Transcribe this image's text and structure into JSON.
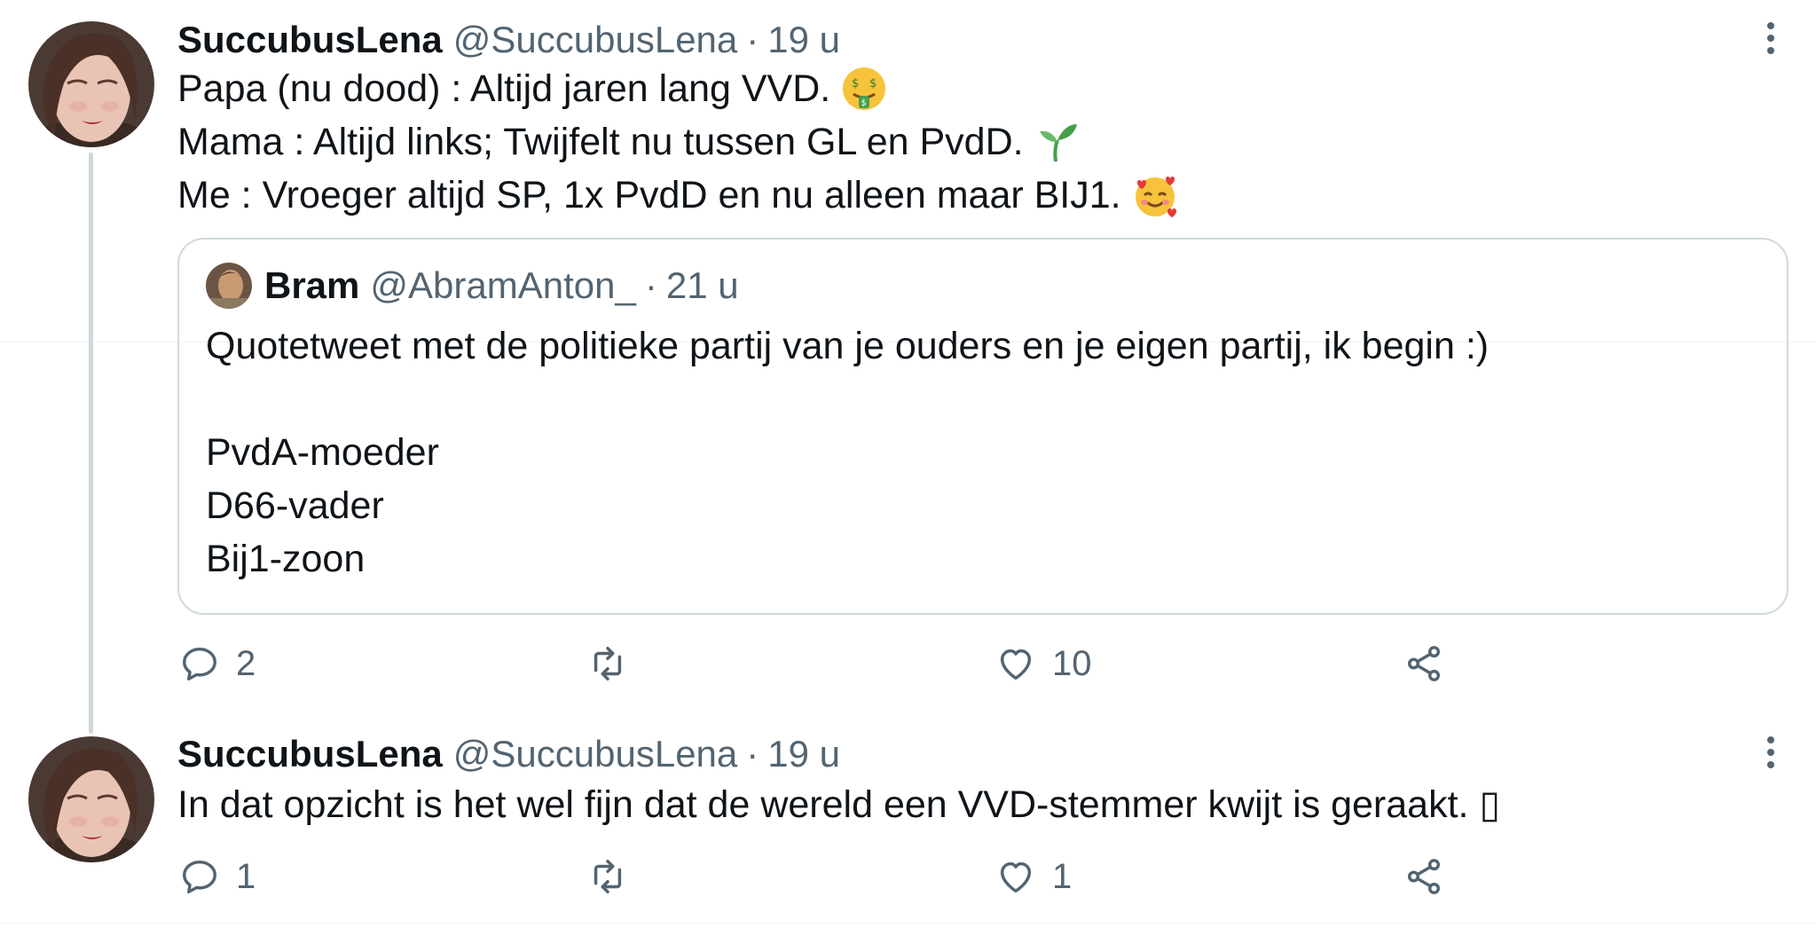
{
  "tweets": [
    {
      "display_name": "SuccubusLena",
      "handle": "@SuccubusLena",
      "separator": "·",
      "time": "19 u",
      "lines": [
        {
          "text": "Papa (nu dood) : Altijd jaren lang VVD.",
          "emoji": "money-mouth-face-emoji"
        },
        {
          "text": "Mama : Altijd links; Twijfelt nu tussen GL en PvdD.",
          "emoji": "seedling-emoji"
        },
        {
          "text": "Me : Vroeger altijd SP, 1x PvdD en nu alleen maar BIJ1.",
          "emoji": "smiling-face-with-hearts-emoji"
        }
      ],
      "quote": {
        "display_name": "Bram",
        "handle": "@AbramAnton_",
        "separator": "·",
        "time": "21 u",
        "lines": [
          "Quotetweet met de politieke partij van je ouders en je eigen partij, ik begin :)",
          "",
          "PvdA-moeder",
          "D66-vader",
          "Bij1-zoon"
        ]
      },
      "actions": {
        "reply_count": "2",
        "retweet_count": "",
        "like_count": "10"
      }
    },
    {
      "display_name": "SuccubusLena",
      "handle": "@SuccubusLena",
      "separator": "·",
      "time": "19 u",
      "lines": [
        {
          "text": "In dat opzicht is het wel fijn dat de wereld een VVD-stemmer kwijt is geraakt. ▯",
          "emoji": ""
        }
      ],
      "actions": {
        "reply_count": "1",
        "retweet_count": "",
        "like_count": "1"
      }
    }
  ],
  "colors": {
    "text": "#0f1419",
    "secondary": "#536471",
    "border": "#cfd9de",
    "thread_line": "#cfd9de"
  },
  "icons": [
    "more-vertical-icon",
    "reply-icon",
    "retweet-icon",
    "like-icon",
    "share-icon"
  ]
}
